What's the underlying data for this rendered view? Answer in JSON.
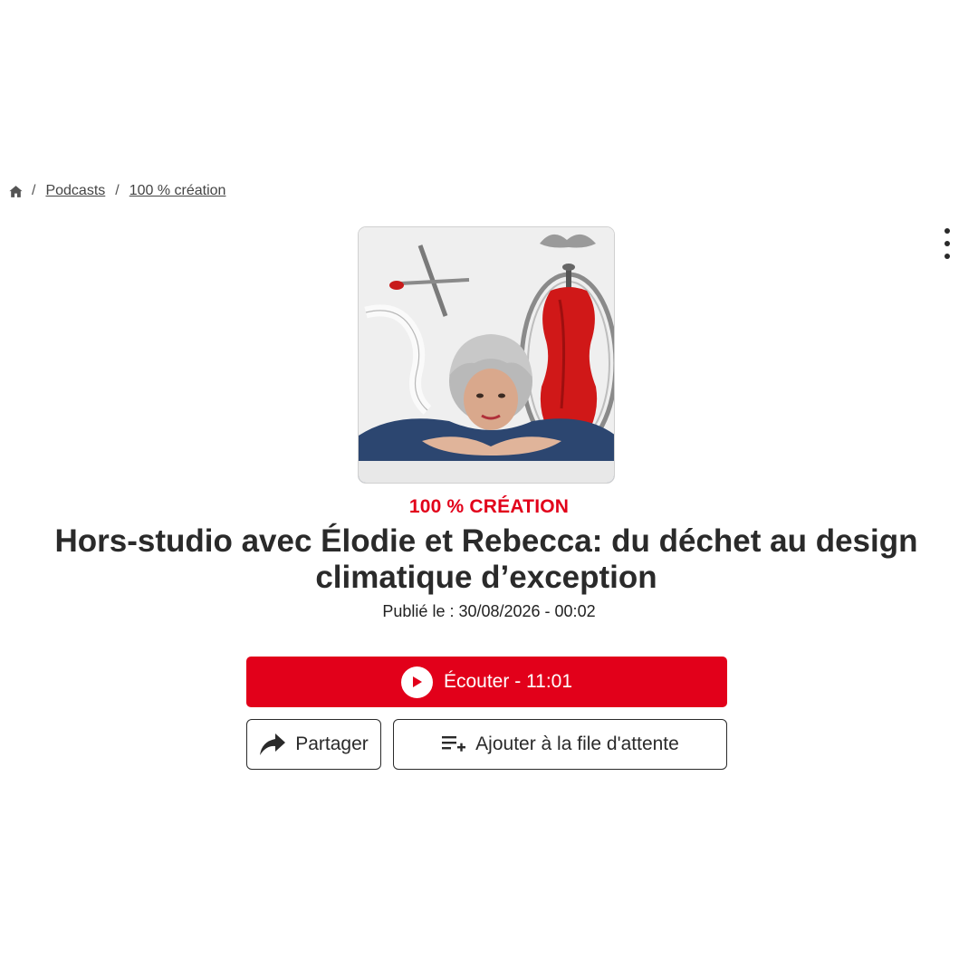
{
  "breadcrumb": {
    "home_icon": "home-icon",
    "separator": "/",
    "items": [
      {
        "label": "Podcasts"
      },
      {
        "label": "100 % création"
      }
    ]
  },
  "menu": {
    "icon": "more-vertical-icon"
  },
  "episode": {
    "show_name": "100 % CRÉATION",
    "title": "Hors-studio avec Élodie et Rebecca: du déchet au design climatique d’exception",
    "published": "Publié le : 30/08/2026 - 00:02"
  },
  "actions": {
    "listen_label": "Écouter - 11:01",
    "listen_icon": "play-icon",
    "share_label": "Partager",
    "share_icon": "share-arrow-icon",
    "queue_label": "Ajouter à la file d'attente",
    "queue_icon": "playlist-add-icon"
  },
  "colors": {
    "accent": "#e2001a",
    "text": "#2a2a2a"
  }
}
